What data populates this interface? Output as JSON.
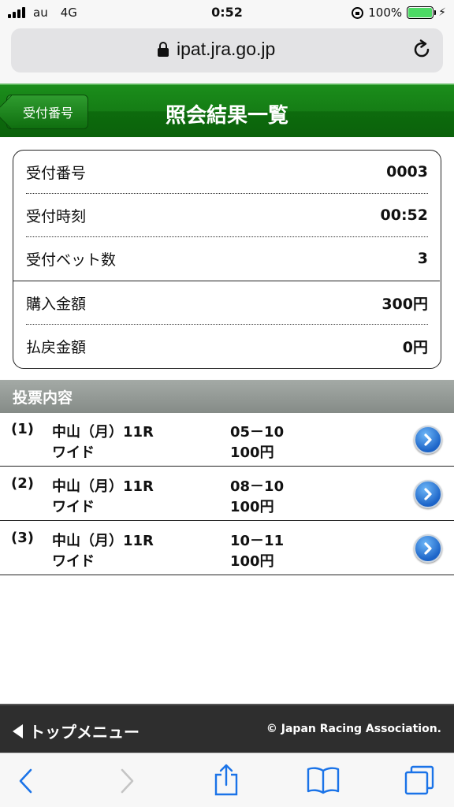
{
  "status": {
    "carrier": "au",
    "network": "4G",
    "time": "0:52",
    "battery": "100%"
  },
  "browser": {
    "url": "ipat.jra.go.jp"
  },
  "header": {
    "back_label": "受付番号",
    "title": "照会結果一覧"
  },
  "summary": {
    "rows": [
      {
        "label": "受付番号",
        "value": "0003"
      },
      {
        "label": "受付時刻",
        "value": "00:52"
      },
      {
        "label": "受付ベット数",
        "value": "3"
      },
      {
        "label": "購入金額",
        "value": "300円"
      },
      {
        "label": "払戻金額",
        "value": "0円"
      }
    ]
  },
  "section": {
    "title": "投票内容"
  },
  "bets": [
    {
      "num": "(1)",
      "race": "中山（月）11R",
      "type": "ワイド",
      "combo": "05－10",
      "amount": "100円"
    },
    {
      "num": "(2)",
      "race": "中山（月）11R",
      "type": "ワイド",
      "combo": "08－10",
      "amount": "100円"
    },
    {
      "num": "(3)",
      "race": "中山（月）11R",
      "type": "ワイド",
      "combo": "10－11",
      "amount": "100円"
    }
  ],
  "footer": {
    "top_menu": "トップメニュー",
    "copyright": "© Japan Racing Association."
  },
  "icons": {
    "go": "chevron-right-circle-icon",
    "back": "back-arrow-icon",
    "share": "share-icon",
    "bookmarks": "book-icon",
    "tabs": "tabs-icon",
    "reload": "reload-icon",
    "lock": "lock-icon"
  },
  "colors": {
    "header_green": "#157d15",
    "section_gray": "#8f9591",
    "footer_dark": "#2e2e2e",
    "link_blue": "#1a73e8"
  }
}
